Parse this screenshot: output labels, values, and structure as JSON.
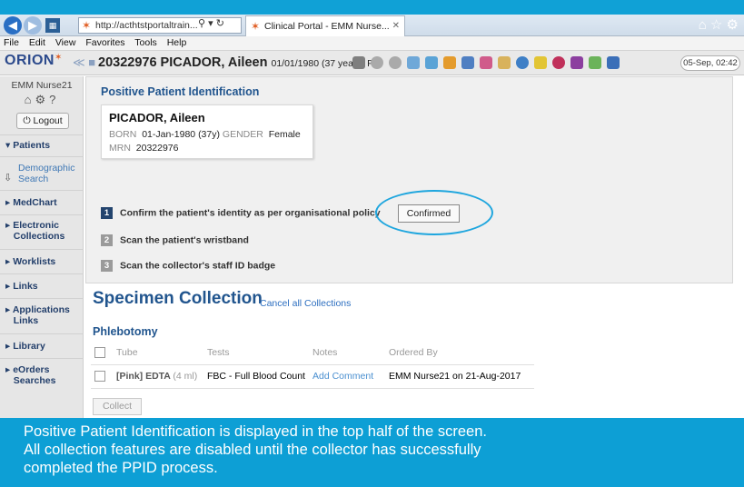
{
  "browser": {
    "url": "http://acthtstportaltrain...",
    "url_tools": "⚲ ▾ ↻",
    "tab_title": "Clinical Portal - EMM Nurse...",
    "menu": [
      "File",
      "Edit",
      "View",
      "Favorites",
      "Tools",
      "Help"
    ]
  },
  "app": {
    "logo": "ORION",
    "patient_header": "20322976 PICADOR, Aileen",
    "patient_header_dob": "01/01/1980 (37 years) F",
    "datetime": "05-Sep, 02:42"
  },
  "sidebar": {
    "user": "EMM Nurse21",
    "logout_label": "Logout",
    "items": {
      "patients": "Patients",
      "demographic": "Demographic",
      "search": "Search",
      "medchart": "MedChart",
      "electronic": "Electronic",
      "collections": "Collections",
      "worklists": "Worklists",
      "links": "Links",
      "applications": "Applications",
      "app_links": "Links",
      "library": "Library",
      "eorders": "eOrders",
      "searches": "Searches"
    }
  },
  "ppid": {
    "title": "Positive Patient Identification",
    "name": "PICADOR, Aileen",
    "born_label": "BORN",
    "born_value": "01-Jan-1980 (37y)",
    "gender_label": "GENDER",
    "gender_value": "Female",
    "mrn_label": "MRN",
    "mrn_value": "20322976",
    "steps": [
      {
        "num": "1",
        "text": "Confirm the patient's identity as per organisational policy"
      },
      {
        "num": "2",
        "text": "Scan the patient's wristband"
      },
      {
        "num": "3",
        "text": "Scan the collector's staff ID badge"
      }
    ],
    "confirmed_label": "Confirmed"
  },
  "specimen": {
    "title": "Specimen Collection",
    "cancel_link": "Cancel all Collections",
    "section": "Phlebotomy",
    "headers": [
      "Tube",
      "Tests",
      "Notes",
      "Ordered By"
    ],
    "row": {
      "tube": "[Pink] EDTA",
      "volume": "(4 ml)",
      "tests": "FBC - Full Blood Count",
      "notes": "Add Comment",
      "ordered_by": "EMM Nurse21 on 21-Aug-2017"
    },
    "collect_label": "Collect"
  },
  "caption": [
    "Positive Patient Identification is displayed in the top half of the screen.",
    "All collection features are disabled until the collector has successfully",
    "completed the PPID process."
  ]
}
